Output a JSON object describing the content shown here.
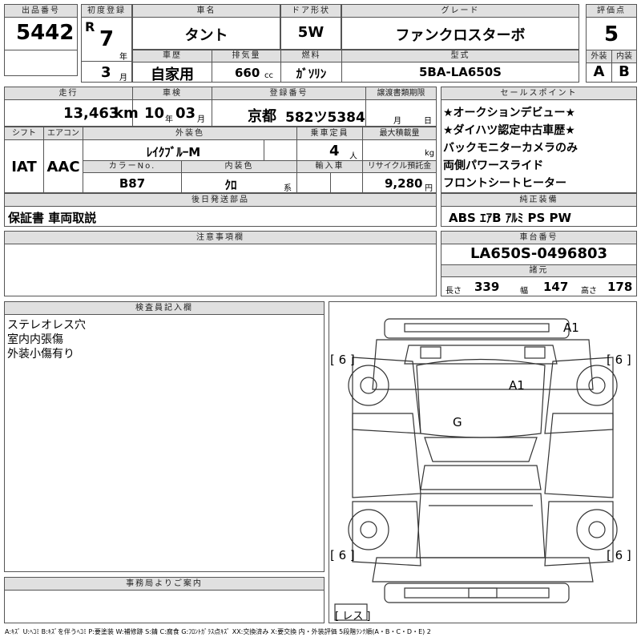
{
  "headers": {
    "lot_no": "出品番号",
    "first_reg": "初度登録",
    "car_name": "車名",
    "door": "ドア形状",
    "grade": "グレード",
    "score": "評価点",
    "car_history": "車歴",
    "displacement": "排気量",
    "fuel": "燃料",
    "model": "型式",
    "exterior": "外装",
    "interior": "内装",
    "mileage": "走行",
    "inspection": "車検",
    "plate": "登録番号",
    "transfer_deadline": "譲渡書類期限",
    "sales_points": "セールスポイント",
    "shift": "シフト",
    "aircon": "エアコン",
    "ext_color": "外装色",
    "capacity": "乗車定員",
    "max_load": "最大積載量",
    "color_no": "カラーNo.",
    "int_color": "内装色",
    "import": "輸入車",
    "recycle": "リサイクル預託金",
    "later_items": "後日発送部品",
    "std_equipment": "純正装備",
    "notes": "注意事項欄",
    "chassis_no": "車台番号",
    "dimensions": "諸元",
    "inspector": "検査員記入欄",
    "office": "事務局よりご案内"
  },
  "lot": {
    "number": "5442"
  },
  "first_reg": {
    "era": "R",
    "year": "7",
    "year_unit": "年",
    "month": "3",
    "month_unit": "月"
  },
  "car": {
    "name": "タント",
    "door": "5W",
    "grade": "ファンクロスターボ",
    "history": "自家用",
    "displacement": "660",
    "displacement_unit": "cc",
    "fuel": "ｶﾞｿﾘﾝ",
    "model": "5BA-LA650S"
  },
  "score": {
    "overall": "5",
    "exterior": "A",
    "interior": "B"
  },
  "mileage": {
    "value": "13,463",
    "unit": "km"
  },
  "inspection": {
    "year": "10",
    "year_unit": "年",
    "month": "03",
    "month_unit": "月"
  },
  "plate": {
    "region": "京都",
    "number": "582ツ5384"
  },
  "transfer": {
    "month_unit": "月",
    "day_unit": "日"
  },
  "shift": "IAT",
  "aircon": "AAC",
  "ext_color": "ﾚｲｸﾌﾞﾙｰM",
  "capacity": {
    "value": "4",
    "unit": "人"
  },
  "max_load": {
    "unit": "kg"
  },
  "color_no": "B87",
  "int_color": {
    "value": "ｸﾛ",
    "unit": "系"
  },
  "recycle": {
    "value": "9,280",
    "unit": "円"
  },
  "later_items": "保証書 車両取説",
  "sales_points": [
    "★オークションデビュー★",
    "★ダイハツ認定中古車歴★",
    "バックモニターカメラのみ",
    "両側パワースライド",
    "フロントシートヒーター"
  ],
  "std_equipment": "ABS ｴｱB ｱﾙﾐ PS PW",
  "chassis_no": "LA650S-0496803",
  "dims": {
    "length_label": "長さ",
    "length": "339",
    "width_label": "幅",
    "width": "147",
    "height_label": "高さ",
    "height": "178"
  },
  "inspector_notes": [
    "ステレオレス穴",
    "室内内張傷",
    "外装小傷有り"
  ],
  "diagram": {
    "marks": [
      "A1",
      "A1",
      "G"
    ],
    "tires": [
      "[ 6 ]",
      "[ 6 ]",
      "[ 6 ]",
      "[ 6 ]"
    ],
    "spare": "[ レス ]"
  },
  "legend": "A:ｷｽﾞ U:ﾍｺﾐ B:ｷｽﾞを伴うﾍｺﾐ P:要塗装 W:補修跡 S:錆 C:腐食 G:ﾌﾛﾝﾄｶﾞﾗｽ点ｷｽﾞ XX:交換済み X:要交換  内・外装評価 5段階ﾗﾝｸ順(A・B・C・D・E) 2"
}
